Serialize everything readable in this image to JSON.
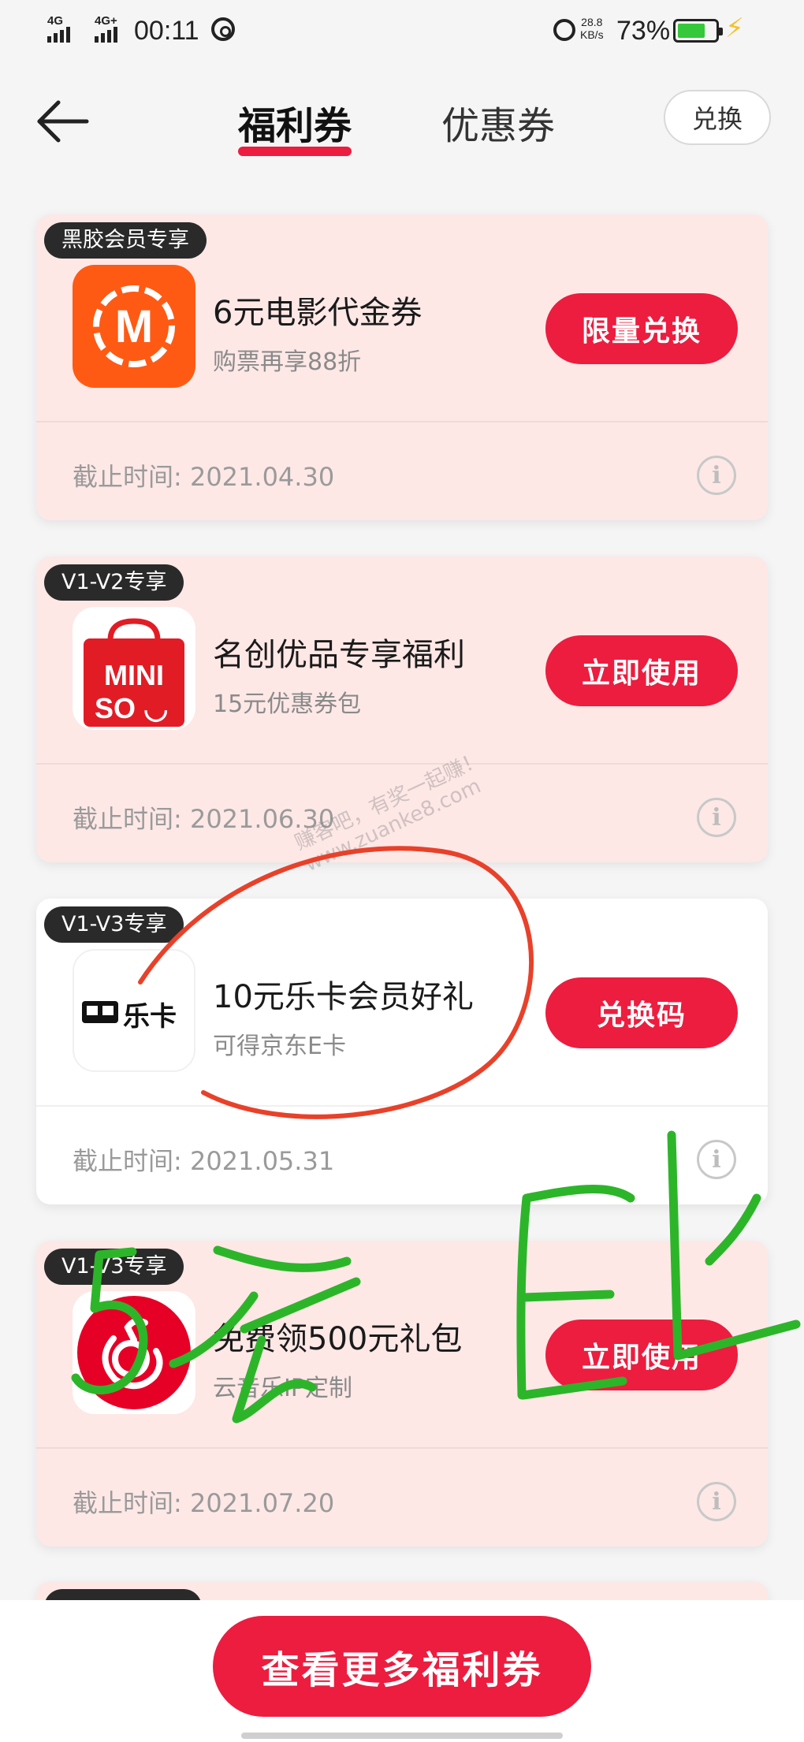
{
  "status_bar": {
    "net1": "4G",
    "net2": "4G+",
    "time": "00:11",
    "speed_value": "28.8",
    "speed_unit": "KB/s",
    "battery_percent": "73%",
    "battery_level": 0.73,
    "battery_color": "#35c83a"
  },
  "header": {
    "tabs": [
      {
        "label": "福利券",
        "active": true
      },
      {
        "label": "优惠券",
        "active": false
      }
    ],
    "redeem_label": "兑换"
  },
  "coupons": [
    {
      "badge": "黑胶会员专享",
      "logo": "maoyan-logo",
      "logo_letter": "M",
      "title": "6元电影代金券",
      "subtitle": "购票再享88折",
      "button": "限量兑换",
      "deadline": "截止时间: 2021.04.30"
    },
    {
      "badge": "V1-V2专享",
      "logo": "miniso-logo",
      "logo_line1": "MINI",
      "logo_line2": "SO",
      "title": "名创优品专享福利",
      "subtitle": "15元优惠券包",
      "button": "立即使用",
      "deadline": "截止时间: 2021.06.30"
    },
    {
      "badge": "V1-V3专享",
      "logo": "leka-logo",
      "logo_text": "乐卡",
      "title": "10元乐卡会员好礼",
      "subtitle": "可得京东E卡",
      "button": "兑换码",
      "deadline": "截止时间: 2021.05.31"
    },
    {
      "badge": "V1-V3专享",
      "logo": "netease-music-logo",
      "title": "免费领500元礼包",
      "subtitle": "云音乐IP定制",
      "button": "立即使用",
      "deadline": "截止时间: 2021.07.20"
    }
  ],
  "watermark": {
    "line1": "赚客吧，有奖一起赚！",
    "line2": "www.zuanke8.com"
  },
  "bottom": {
    "more_label": "查看更多福利券"
  },
  "colors": {
    "accent": "#ec1d3f",
    "card_pink": "#fde8e6",
    "annotation_red": "#e8412a",
    "annotation_green": "#2db52a"
  }
}
